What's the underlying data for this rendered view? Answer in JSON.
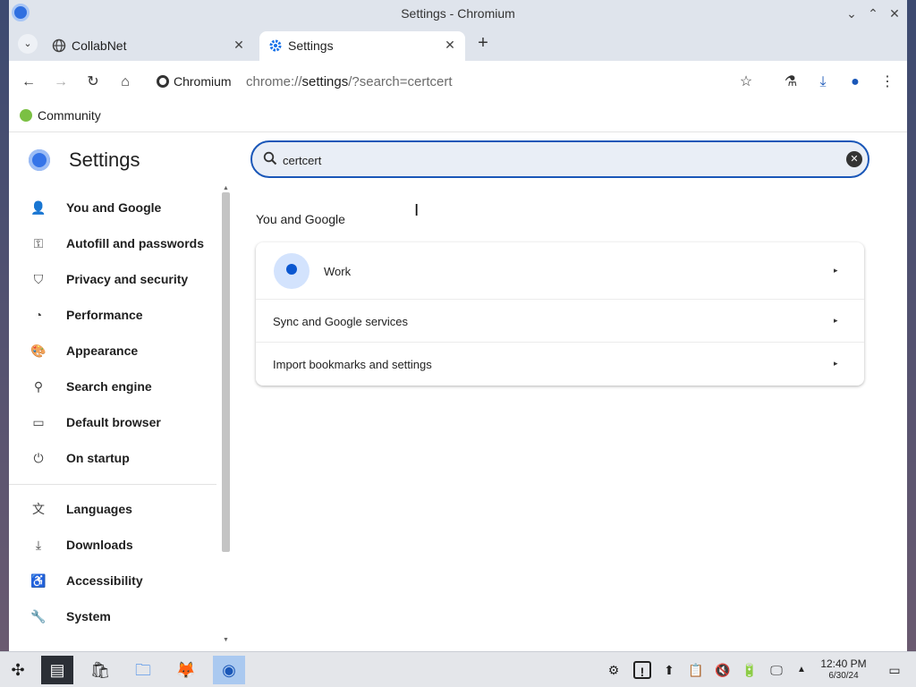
{
  "window": {
    "title": "Settings - Chromium",
    "minimize_glyph": "⌄",
    "maximize_glyph": "⌃",
    "close_glyph": "✕"
  },
  "tabs": [
    {
      "label": "CollabNet",
      "icon": "globe-icon",
      "close_glyph": "✕"
    },
    {
      "label": "Settings",
      "icon": "gear-icon",
      "close_glyph": "✕"
    }
  ],
  "new_tab_glyph": "+",
  "tab_dropdown_glyph": "⌄",
  "toolbar": {
    "back_glyph": "←",
    "forward_glyph": "→",
    "reload_glyph": "↻",
    "home_glyph": "⌂",
    "site_chip": "Chromium",
    "url_scheme": "chrome://",
    "url_host": "settings",
    "url_path": "/?search=certcert",
    "star_glyph": "☆",
    "labs_glyph": "⚗",
    "download_glyph": "⤓",
    "profile_glyph": "●",
    "menu_glyph": "⋮"
  },
  "bookmarks": [
    {
      "label": "Community"
    }
  ],
  "settings": {
    "title": "Settings",
    "search_value": "certcert",
    "search_icon": "search-icon",
    "clear_glyph": "✕",
    "nav": [
      {
        "label": "You and Google",
        "icon": "person-icon",
        "glyph": "👤"
      },
      {
        "label": "Autofill and passwords",
        "icon": "key-icon",
        "glyph": "⚿"
      },
      {
        "label": "Privacy and security",
        "icon": "shield-icon",
        "glyph": "⛉"
      },
      {
        "label": "Performance",
        "icon": "speedometer-icon",
        "glyph": "◔"
      },
      {
        "label": "Appearance",
        "icon": "palette-icon",
        "glyph": "🎨"
      },
      {
        "label": "Search engine",
        "icon": "search-icon",
        "glyph": "⚲"
      },
      {
        "label": "Default browser",
        "icon": "browser-icon",
        "glyph": "▭"
      },
      {
        "label": "On startup",
        "icon": "power-icon",
        "glyph": "⏻"
      },
      {
        "label": "Languages",
        "icon": "translate-icon",
        "glyph": "文"
      },
      {
        "label": "Downloads",
        "icon": "download-icon",
        "glyph": "⤓"
      },
      {
        "label": "Accessibility",
        "icon": "accessibility-icon",
        "glyph": "♿"
      },
      {
        "label": "System",
        "icon": "wrench-icon",
        "glyph": "🔧"
      }
    ],
    "section_title": "You and Google",
    "rows": [
      {
        "label": "Work",
        "arrow_glyph": "▸"
      },
      {
        "label": "Sync and Google services",
        "arrow_glyph": "▸"
      },
      {
        "label": "Import bookmarks and settings",
        "arrow_glyph": "▸"
      }
    ]
  },
  "taskbar": {
    "apps": [
      {
        "name": "application-launcher-icon",
        "glyph": "✣"
      },
      {
        "name": "terminal-icon",
        "glyph": "▤"
      },
      {
        "name": "store-icon",
        "glyph": "🛍"
      },
      {
        "name": "file-manager-icon",
        "glyph": "🗀"
      },
      {
        "name": "firefox-icon",
        "glyph": "🦊"
      },
      {
        "name": "chromium-icon",
        "glyph": "◉"
      }
    ],
    "tray": [
      {
        "name": "network-settings-icon",
        "glyph": "⚙"
      },
      {
        "name": "notification-icon",
        "glyph": "!"
      },
      {
        "name": "updates-icon",
        "glyph": "⬆"
      },
      {
        "name": "clipboard-icon",
        "glyph": "📋"
      },
      {
        "name": "volume-muted-icon",
        "glyph": "🔇"
      },
      {
        "name": "battery-icon",
        "glyph": "🔋"
      },
      {
        "name": "display-icon",
        "glyph": "🖵"
      },
      {
        "name": "tray-expand-icon",
        "glyph": "▲"
      }
    ],
    "time": "12:40 PM",
    "date": "6/30/24",
    "show_desktop_glyph": "▭"
  }
}
